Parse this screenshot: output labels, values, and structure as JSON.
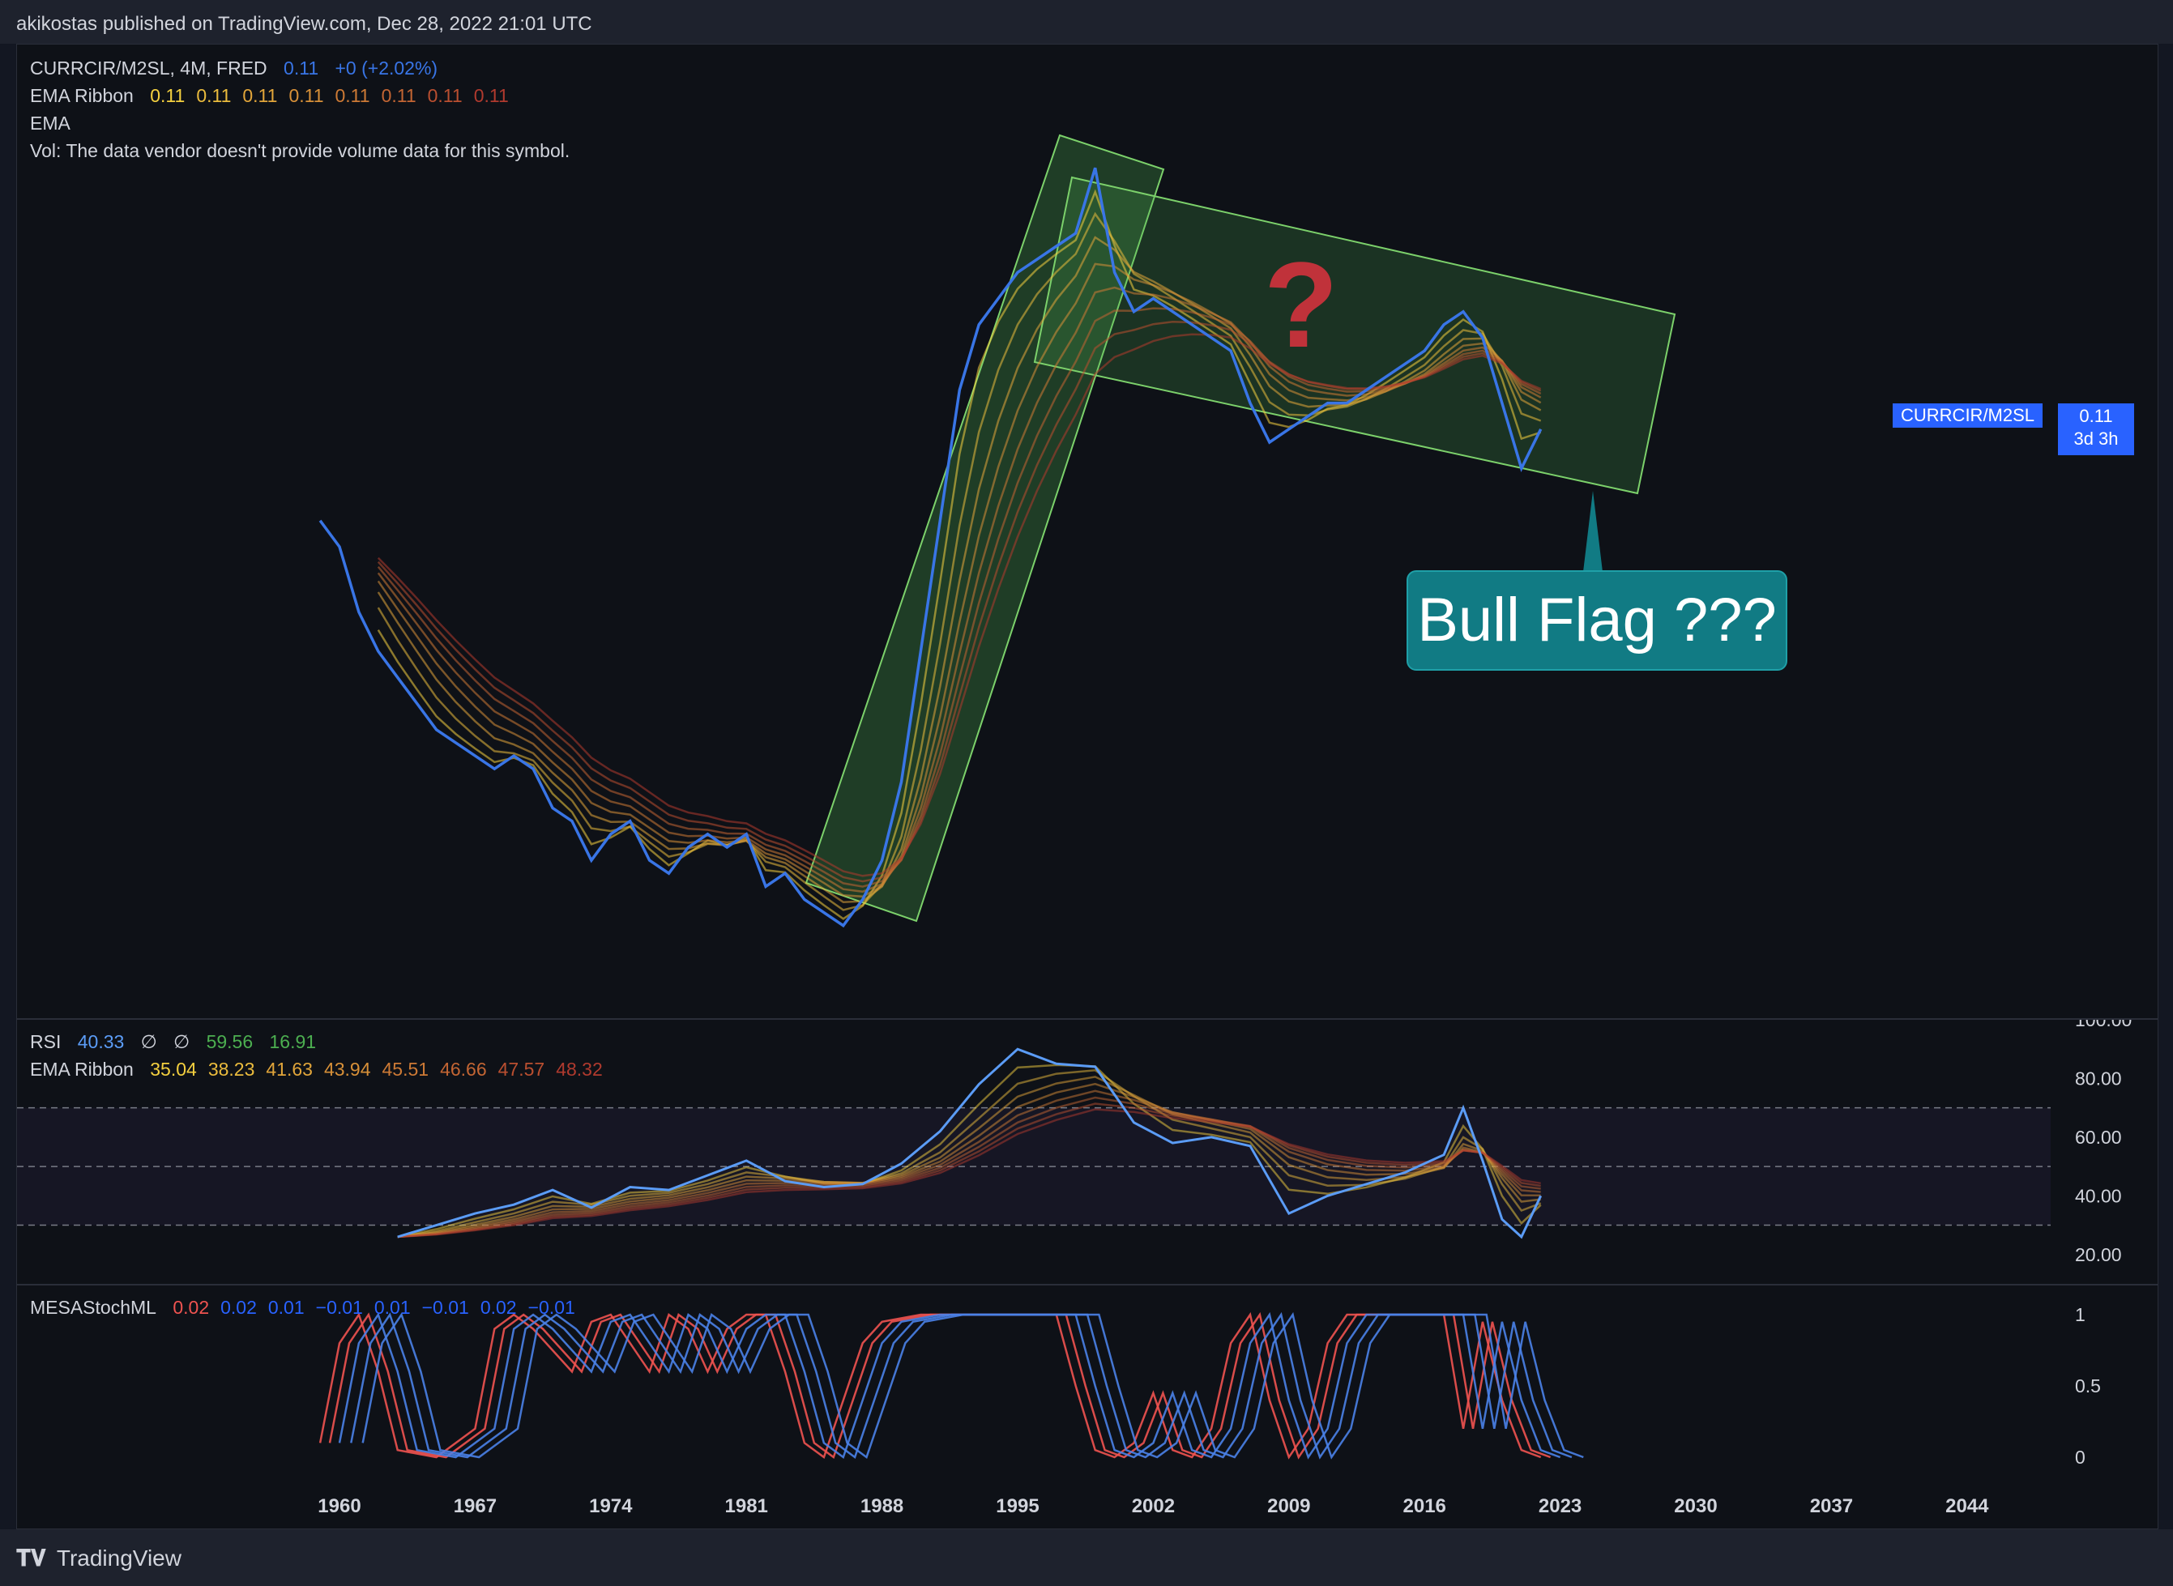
{
  "header": {
    "publish_text": "akikostas published on TradingView.com, Dec 28, 2022 21:01 UTC"
  },
  "main_legend": {
    "symbol_line": "CURRCIR/M2SL, 4M, FRED",
    "symbol_value": "0.11",
    "symbol_change": "+0 (+2.02%)",
    "ema_ribbon_label": "EMA Ribbon",
    "ema_ribbon_values": [
      "0.11",
      "0.11",
      "0.11",
      "0.11",
      "0.11",
      "0.11",
      "0.11",
      "0.11"
    ],
    "ema_label": "EMA",
    "vol_label": "Vol: The data vendor doesn't provide volume data for this symbol."
  },
  "price_scale": {
    "symbol_tag": "CURRCIR/M2SL",
    "value": "0.11",
    "countdown": "3d 3h"
  },
  "annotations": {
    "callout": "Bull Flag ???",
    "question_mark": "?"
  },
  "rsi_legend": {
    "label": "RSI",
    "value": "40.33",
    "na1": "∅",
    "na2": "∅",
    "v3": "59.56",
    "v4": "16.91",
    "ema_ribbon_label": "EMA Ribbon",
    "ema_ribbon_values": [
      "35.04",
      "38.23",
      "41.63",
      "43.94",
      "45.51",
      "46.66",
      "47.57",
      "48.32"
    ]
  },
  "mesa_legend": {
    "label": "MESAStochML",
    "values": [
      "0.02",
      "0.02",
      "0.01",
      "−0.01",
      "0.01",
      "−0.01",
      "0.02",
      "−0.01"
    ]
  },
  "colors": {
    "price_line": "#3975e6",
    "ribbon_start": "#f4d03f",
    "ribbon_end": "#b03a2e",
    "channel_fill": "#4caf50",
    "callout_bg": "#117b84",
    "accent": "#2962ff"
  },
  "footer": {
    "logo_text": "TradingView"
  },
  "chart_data": [
    {
      "type": "line",
      "title": "CURRCIR/M2SL, 4M, FRED",
      "x": [
        1959,
        1960,
        1961,
        1962,
        1963,
        1964,
        1965,
        1966,
        1967,
        1968,
        1969,
        1970,
        1971,
        1972,
        1973,
        1974,
        1975,
        1976,
        1977,
        1978,
        1979,
        1980,
        1981,
        1982,
        1983,
        1984,
        1985,
        1986,
        1987,
        1988,
        1989,
        1990,
        1991,
        1992,
        1993,
        1994,
        1995,
        1996,
        1997,
        1998,
        1999,
        2000,
        2001,
        2002,
        2003,
        2004,
        2005,
        2006,
        2007,
        2008,
        2009,
        2010,
        2011,
        2012,
        2013,
        2014,
        2015,
        2016,
        2017,
        2018,
        2019,
        2020,
        2021,
        2022
      ],
      "series": [
        {
          "name": "CURRCIR/M2SL",
          "values": [
            0.095,
            0.093,
            0.088,
            0.085,
            0.083,
            0.081,
            0.079,
            0.078,
            0.077,
            0.076,
            0.077,
            0.076,
            0.073,
            0.072,
            0.069,
            0.071,
            0.072,
            0.069,
            0.068,
            0.07,
            0.071,
            0.07,
            0.071,
            0.067,
            0.068,
            0.066,
            0.065,
            0.064,
            0.066,
            0.069,
            0.075,
            0.085,
            0.095,
            0.105,
            0.11,
            0.112,
            0.114,
            0.115,
            0.116,
            0.117,
            0.122,
            0.114,
            0.111,
            0.112,
            0.111,
            0.11,
            0.109,
            0.108,
            0.104,
            0.101,
            0.102,
            0.103,
            0.104,
            0.104,
            0.105,
            0.106,
            0.107,
            0.108,
            0.11,
            0.111,
            0.109,
            0.104,
            0.099,
            0.102
          ]
        }
      ],
      "ribbon_lines": 8
    },
    {
      "type": "line",
      "title": "RSI",
      "ylim": [
        10,
        100
      ],
      "yticks": [
        "100.00",
        "80.00",
        "60.00",
        "40.00",
        "20.00"
      ],
      "x": [
        1963,
        1965,
        1967,
        1969,
        1971,
        1973,
        1975,
        1977,
        1979,
        1981,
        1983,
        1985,
        1987,
        1989,
        1991,
        1993,
        1995,
        1997,
        1999,
        2001,
        2003,
        2005,
        2007,
        2009,
        2011,
        2013,
        2015,
        2017,
        2018,
        2019,
        2020,
        2021,
        2022
      ],
      "series": [
        {
          "name": "RSI",
          "values": [
            26,
            30,
            34,
            37,
            42,
            36,
            43,
            42,
            47,
            52,
            45,
            43,
            44,
            51,
            62,
            78,
            90,
            85,
            84,
            65,
            58,
            60,
            57,
            34,
            40,
            44,
            48,
            54,
            70,
            52,
            32,
            26,
            40
          ]
        }
      ],
      "bands": [
        30,
        50,
        70
      ]
    },
    {
      "type": "line",
      "title": "MESAStochML",
      "ylim": [
        0,
        1
      ],
      "yticks": [
        "1",
        "0.5",
        "0"
      ],
      "xticks": [
        "1960",
        "1967",
        "1974",
        "1981",
        "1988",
        "1995",
        "2002",
        "2009",
        "2016",
        "2023",
        "2030",
        "2037",
        "2044"
      ],
      "x": [
        1959,
        1960,
        1961,
        1962,
        1963,
        1965,
        1967,
        1968,
        1969,
        1970,
        1972,
        1973,
        1974,
        1975,
        1976,
        1977,
        1978,
        1979,
        1980,
        1981,
        1982,
        1983,
        1984,
        1985,
        1986,
        1987,
        1988,
        1990,
        1992,
        1995,
        1997,
        1998,
        1999,
        2000,
        2001,
        2002,
        2003,
        2004,
        2005,
        2006,
        2007,
        2008,
        2009,
        2010,
        2011,
        2012,
        2013,
        2014,
        2015,
        2016,
        2017,
        2018,
        2019,
        2020,
        2021,
        2022
      ],
      "series": [
        {
          "name": "MESAStochML",
          "values": [
            0.1,
            0.8,
            1.0,
            0.6,
            0.05,
            0.0,
            0.2,
            0.9,
            1.0,
            0.9,
            0.6,
            0.95,
            1.0,
            0.8,
            0.6,
            1.0,
            0.9,
            0.6,
            0.9,
            1.0,
            1.0,
            0.6,
            0.1,
            0.0,
            0.4,
            0.8,
            0.95,
            1.0,
            1.0,
            1.0,
            1.0,
            0.5,
            0.05,
            0.0,
            0.1,
            0.45,
            0.05,
            0.0,
            0.2,
            0.8,
            1.0,
            0.4,
            0.0,
            0.2,
            0.8,
            1.0,
            1.0,
            1.0,
            1.0,
            1.0,
            1.0,
            0.2,
            0.95,
            0.4,
            0.05,
            0.0
          ]
        }
      ]
    }
  ]
}
